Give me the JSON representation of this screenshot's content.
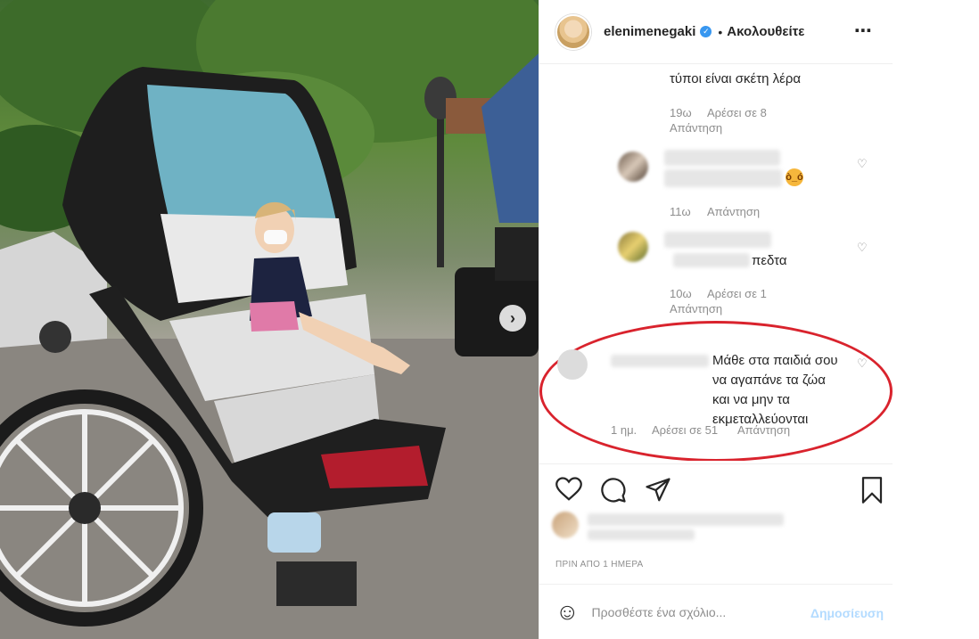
{
  "header": {
    "username": "elenimenegaki",
    "separator": "•",
    "follow_label": "Ακολουθείτε",
    "more_icon": "⋯"
  },
  "comments": [
    {
      "text": "τύποι είναι σκέτη λέρα",
      "time": "19ω",
      "likes": "Αρέσει σε 8",
      "reply": "Απάντηση"
    },
    {
      "time": "11ω",
      "reply": "Απάντηση"
    },
    {
      "text_tail": "πεδτα",
      "time": "10ω",
      "likes": "Αρέσει σε 1",
      "reply": "Απάντηση"
    },
    {
      "text": "Μάθε στα παιδιά σου να αγαπάνε τα ζώα και να μην τα εκμεταλλεύονται",
      "time": "1 ημ.",
      "likes": "Αρέσει σε 51",
      "reply": "Απάντηση"
    }
  ],
  "post": {
    "time_ago": "ΠΡΙΝ ΑΠΟ 1 ΗΜΕΡΑ",
    "comment_placeholder": "Προσθέστε ένα σχόλιο...",
    "publish_label": "Δημοσίευση"
  },
  "icons": {
    "next": "›",
    "heart": "♡",
    "smiley": "☺"
  },
  "colors": {
    "highlight_oval": "#d9232d",
    "verified_badge": "#3897f0",
    "publish_disabled": "#b3dbff"
  }
}
